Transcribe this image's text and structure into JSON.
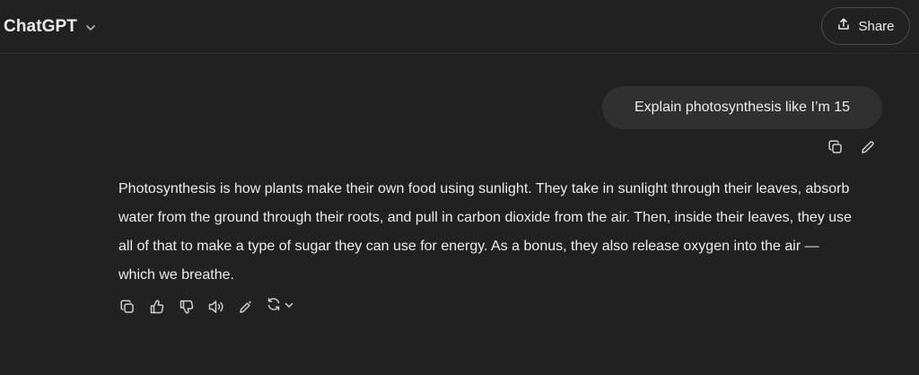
{
  "header": {
    "model_name": "ChatGPT",
    "share_label": "Share"
  },
  "conversation": {
    "user_message": "Explain photosynthesis like I’m 15",
    "assistant_message": "Photosynthesis is how plants make their own food using sunlight. They take in sunlight through their leaves, absorb water from the ground through their roots, and pull in carbon dioxide from the air. Then, inside their leaves, they use all of that to make a type of sugar they can use for energy. As a bonus, they also release oxygen into the air — which we breathe."
  },
  "icons": {
    "model_dropdown": "chevron-down-icon",
    "share": "share-upload-icon",
    "user_actions": [
      "copy-icon",
      "edit-pencil-icon"
    ],
    "assistant_actions": [
      "copy-icon",
      "thumbs-up-icon",
      "thumbs-down-icon",
      "speaker-icon",
      "edit-sparkle-icon",
      "regenerate-icon",
      "chevron-down-icon"
    ]
  },
  "colors": {
    "background": "#212121",
    "user_bubble": "#303030",
    "text": "#ececec",
    "icon": "#cdcdcd",
    "border": "#4a4a4a"
  }
}
